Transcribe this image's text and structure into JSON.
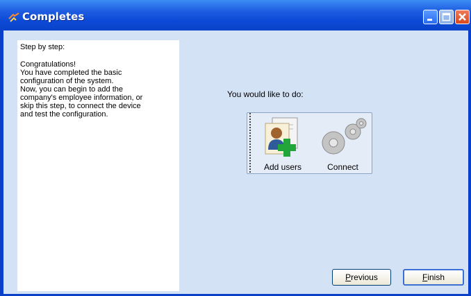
{
  "window": {
    "title": "Completes"
  },
  "left": {
    "heading": "Step by step:",
    "body": "Congratulations!\nYou have completed the basic\nconfiguration of the system.\nNow, you can begin to add the\ncompany's employee information, or\nskip this step, to connect the device\nand test the configuration."
  },
  "main": {
    "prompt": "You would like to do:",
    "options": [
      {
        "label": "Add users",
        "icon": "add-users-icon"
      },
      {
        "label": "Connect",
        "icon": "gears-icon"
      }
    ]
  },
  "buttons": {
    "previous_first": "P",
    "previous_rest": "revious",
    "finish_first": "F",
    "finish_rest": "inish"
  }
}
